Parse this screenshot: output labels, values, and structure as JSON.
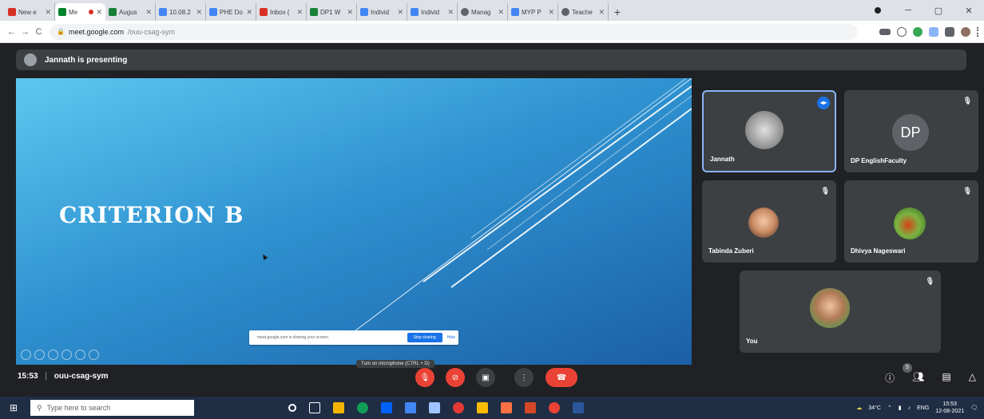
{
  "browser": {
    "tabs": [
      {
        "title": "New e",
        "color": "#d93025"
      },
      {
        "title": "Me",
        "color": "#00832d",
        "active": true,
        "recording": true
      },
      {
        "title": "Augus",
        "color": "#188038"
      },
      {
        "title": "10.08.2",
        "color": "#4285f4"
      },
      {
        "title": "PHE Do",
        "color": "#4285f4"
      },
      {
        "title": "Inbox (",
        "color": "#d93025"
      },
      {
        "title": "DP1 W",
        "color": "#188038"
      },
      {
        "title": "Individ",
        "color": "#4285f4"
      },
      {
        "title": "Individ",
        "color": "#4285f4"
      },
      {
        "title": "Manag",
        "color": "#5f6368"
      },
      {
        "title": "MYP P",
        "color": "#4285f4"
      },
      {
        "title": "Teache",
        "color": "#5f6368"
      }
    ],
    "new_tab": "+",
    "window_controls": {
      "minimize": "─",
      "maximize": "▢",
      "close": "✕"
    },
    "url_domain": "meet.google.com",
    "url_path": "/ouu-csag-sym",
    "nav": {
      "back": "←",
      "forward": "→",
      "reload": "C"
    }
  },
  "meet": {
    "presenter_text": "Jannath is presenting",
    "slide_title": "CRITERION B",
    "sharing_notice": "meet.google.com is sharing your screen.",
    "stop_sharing": "Stop sharing",
    "hide": "Hide",
    "participants": [
      {
        "name": "Jannath",
        "active_speaker": true
      },
      {
        "name": "DP EnglishFaculty",
        "initials": "DP"
      },
      {
        "name": "Tabinda Zuberi"
      },
      {
        "name": "Dhivya Nageswari"
      },
      {
        "name": "You"
      }
    ],
    "time": "15:53",
    "separator": "|",
    "meeting_code": "ouu-csag-sym",
    "mic_tooltip": "Turn on microphone (CTRL + D)",
    "people_count": "5"
  },
  "taskbar": {
    "search_placeholder": "Type here to search",
    "weather": "34°C",
    "language": "ENG",
    "clock_time": "15:53",
    "clock_date": "12-08-2021"
  }
}
